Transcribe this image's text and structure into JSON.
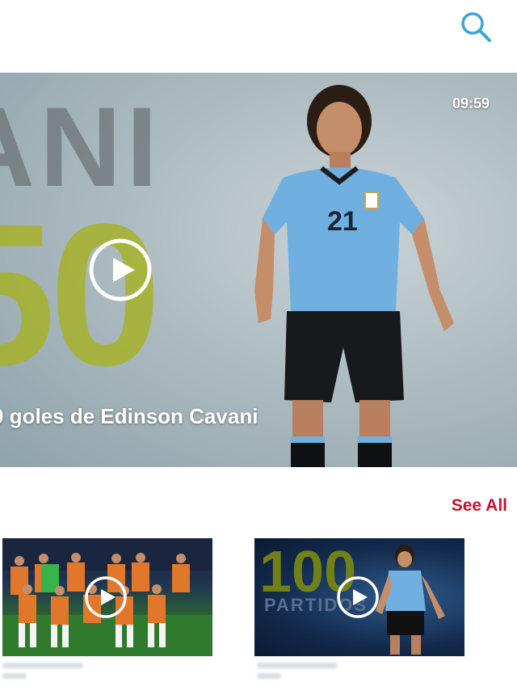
{
  "header": {
    "search_icon": "search-icon",
    "accent": "#3aa5d9"
  },
  "hero": {
    "bg_text_top": "ANI",
    "bg_text_number": "50",
    "duration": "09:59",
    "title": "0 goles de Edinson Cavani",
    "jersey_number": "21"
  },
  "section": {
    "see_all_label": "See All",
    "see_all_color": "#c8102e"
  },
  "cards": [
    {
      "thumb": "team-photo",
      "play_icon": "play-icon"
    },
    {
      "thumb": "player-celebration",
      "number": "100",
      "word": "PARTIDOS",
      "play_icon": "play-icon"
    }
  ]
}
